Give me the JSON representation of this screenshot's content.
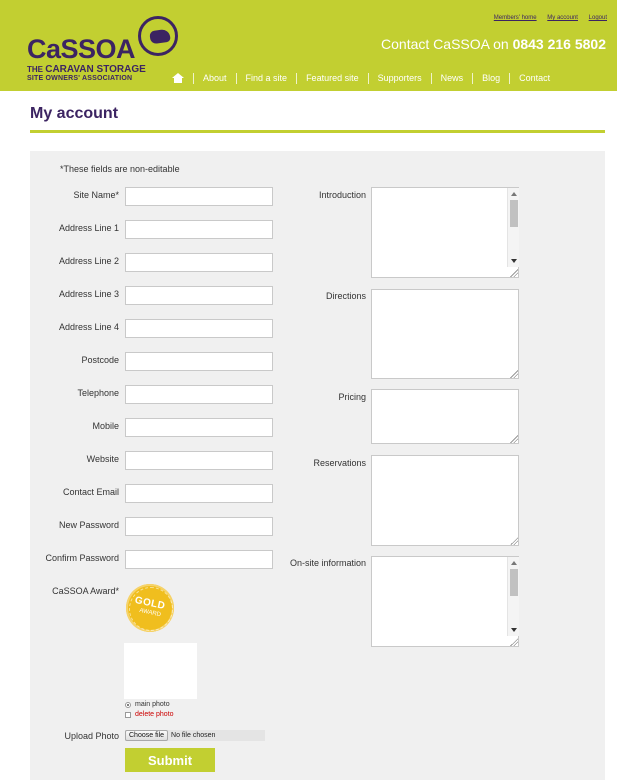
{
  "brand": {
    "name": "CaSSOA",
    "tagline_line1_prefix": "THE ",
    "tagline_line1": "CARAVAN STORAGE",
    "tagline_line2": "SITE OWNERS' ASSOCIATION",
    "color_primary": "#c2cf31",
    "color_secondary": "#3c2462"
  },
  "top_links": [
    "Members' home",
    "My account",
    "Logout"
  ],
  "contact": {
    "prefix": "Contact CaSSOA on ",
    "phone": "0843 216 5802"
  },
  "nav": {
    "home_icon": "home-icon",
    "items": [
      "About",
      "Find a site",
      "Featured site",
      "Supporters",
      "News",
      "Blog",
      "Contact"
    ]
  },
  "page": {
    "title": "My account"
  },
  "form": {
    "note": "*These fields are non-editable",
    "left_fields": [
      {
        "label": "Site Name*",
        "value": ""
      },
      {
        "label": "Address Line 1",
        "value": ""
      },
      {
        "label": "Address Line 2",
        "value": ""
      },
      {
        "label": "Address Line 3",
        "value": ""
      },
      {
        "label": "Address Line 4",
        "value": ""
      },
      {
        "label": "Postcode",
        "value": ""
      },
      {
        "label": "Telephone",
        "value": ""
      },
      {
        "label": "Mobile",
        "value": ""
      },
      {
        "label": "Website",
        "value": ""
      },
      {
        "label": "Contact Email",
        "value": ""
      },
      {
        "label": "New Password",
        "value": ""
      },
      {
        "label": "Confirm Password",
        "value": ""
      }
    ],
    "right_fields": [
      {
        "label": "Introduction",
        "value": ""
      },
      {
        "label": "Directions",
        "value": ""
      },
      {
        "label": "Pricing",
        "value": ""
      },
      {
        "label": "Reservations",
        "value": ""
      },
      {
        "label": "On-site information",
        "value": ""
      }
    ],
    "award": {
      "label": "CaSSOA Award*",
      "badge_line1": "GOLD",
      "badge_line2": "AWARD"
    },
    "photo_options": [
      {
        "label": "main photo",
        "selected": true,
        "color": "#333333"
      },
      {
        "label": "delete photo",
        "selected": false,
        "color": "#cc0000"
      }
    ],
    "upload": {
      "label": "Upload Photo",
      "button": "Choose file",
      "status": "No file chosen"
    },
    "submit": "Submit"
  }
}
